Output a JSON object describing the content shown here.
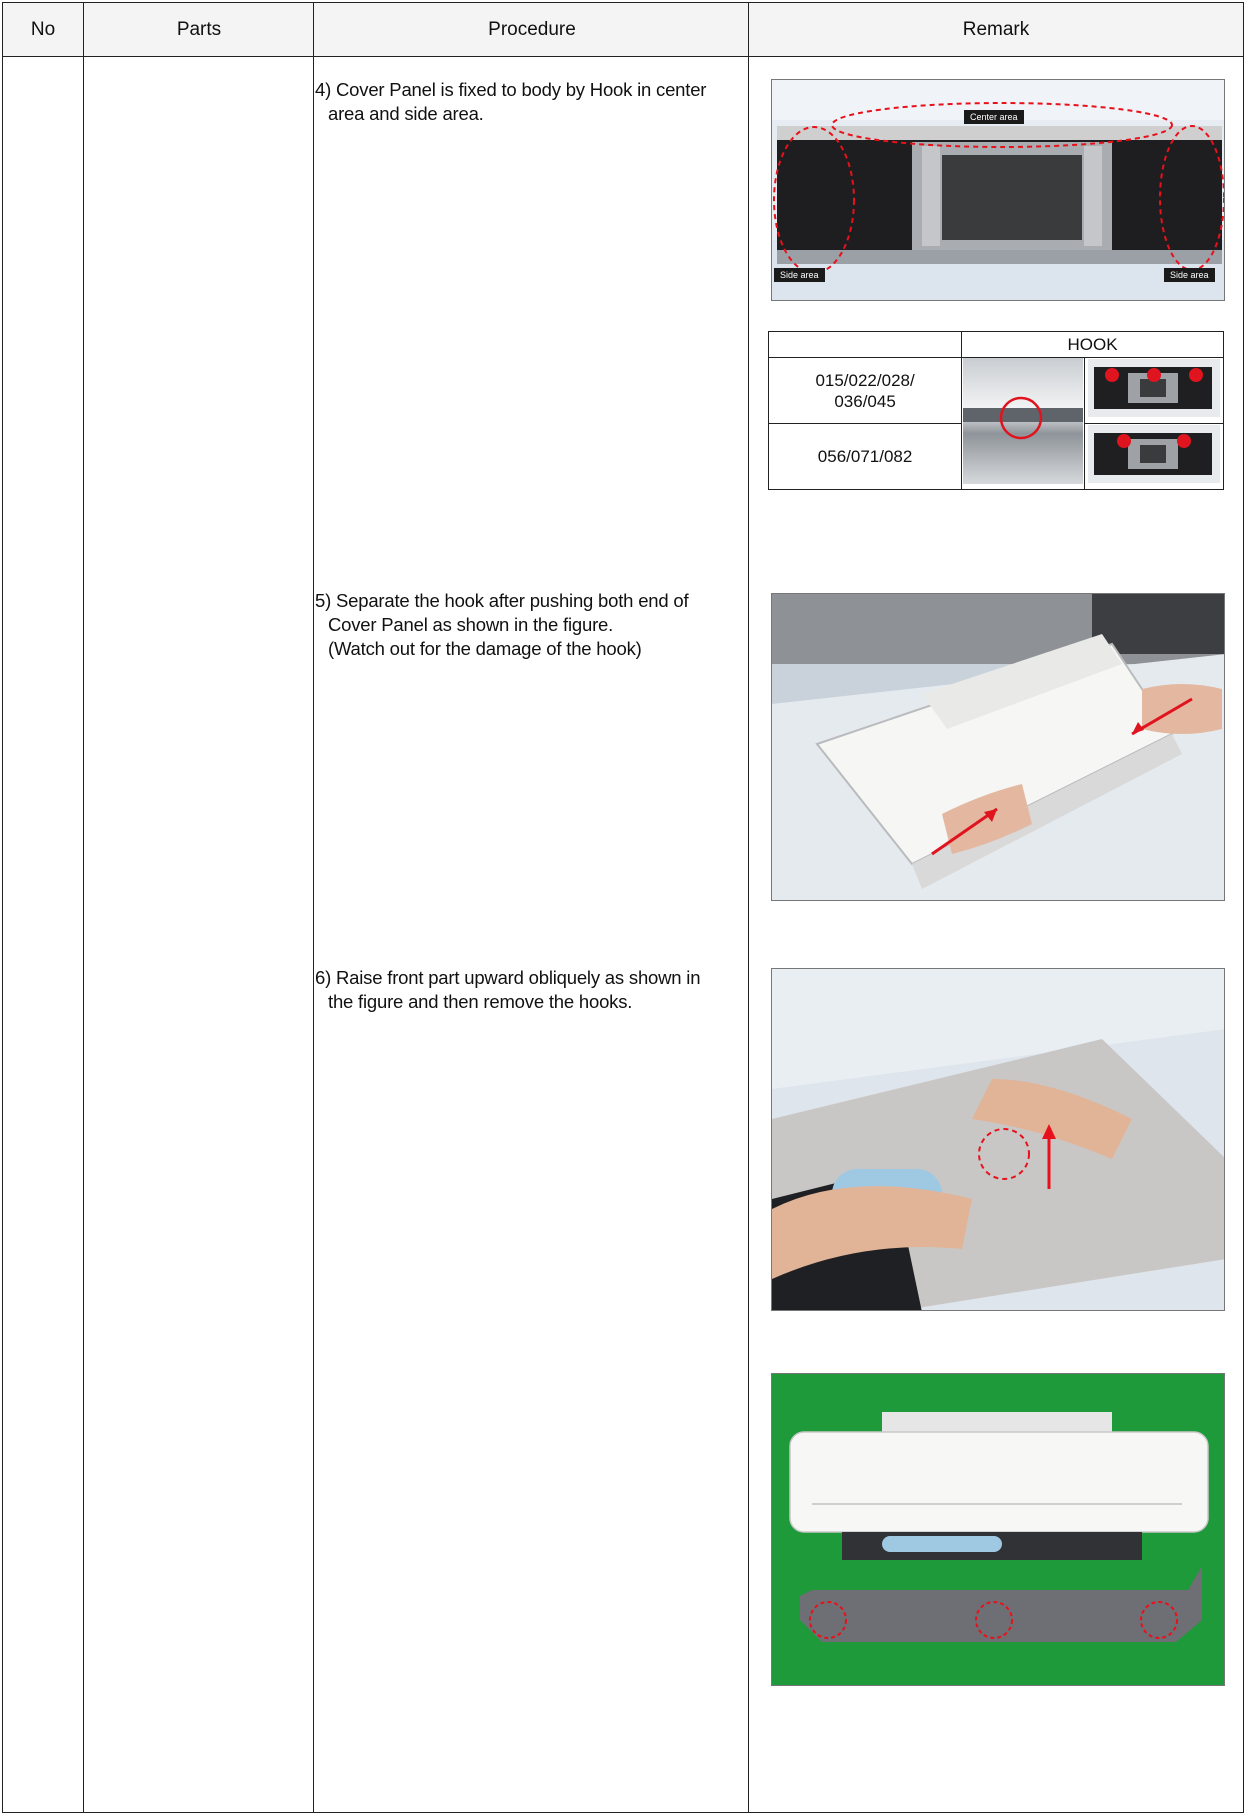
{
  "header": {
    "no": "No",
    "parts": "Parts",
    "procedure": "Procedure",
    "remark": "Remark"
  },
  "steps": [
    {
      "num": "4)",
      "line1": "Cover Panel is fixed to body by Hook in center",
      "line2": "area and side area.",
      "line3": ""
    },
    {
      "num": "5)",
      "line1": "Separate the hook after pushing both end of",
      "line2": "Cover Panel as shown in the figure.",
      "line3": "(Watch out for the damage of the hook)"
    },
    {
      "num": "6)",
      "line1": "Raise front part  upward obliquely as shown in",
      "line2": "the figure and then remove the hooks.",
      "line3": ""
    }
  ],
  "figure1": {
    "center_label": "Center area",
    "side_left_label": "Side area",
    "side_right_label": "Side area"
  },
  "hook_table": {
    "header": "HOOK",
    "rows": [
      {
        "models": "015/022/028/\n036/045"
      },
      {
        "models": "056/071/082"
      }
    ]
  },
  "colors": {
    "marker_red": "#e0141e",
    "dash_red": "#e8111b",
    "floor_green": "#1e9a3b"
  }
}
